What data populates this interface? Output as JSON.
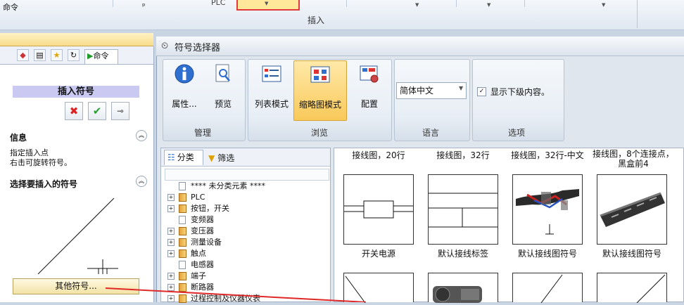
{
  "top_ribbon": {
    "plc_label": "PLC",
    "group_label": "插入"
  },
  "command_panel": {
    "title": "命令",
    "pin_glyph": "ᵖ",
    "tab_label": "命令",
    "insert_symbol_title": "插入符号",
    "buttons": {
      "cancel_glyph": "✖",
      "ok_glyph": "✔",
      "pin_glyph": "⊸"
    },
    "info_section": {
      "title": "信息",
      "lines": [
        "指定插入点",
        "右击可旋转符号。"
      ]
    },
    "choose_section": {
      "title": "选择要插入的符号"
    },
    "other_symbols_label": "其他符号..."
  },
  "selector": {
    "window_title": "符号选择器",
    "groups": [
      {
        "label": "管理",
        "buttons": [
          "属性...",
          "预览"
        ]
      },
      {
        "label": "浏览",
        "buttons": [
          "列表模式",
          "缩略图模式",
          "配置"
        ]
      },
      {
        "label": "语言",
        "select_value": "简体中文"
      },
      {
        "label": "选项",
        "checkbox_label": "显示下级内容。",
        "checkbox_checked": true
      }
    ],
    "tree_tabs": {
      "category": "分类",
      "filter": "筛选"
    },
    "tree_items": [
      {
        "label": "**** 未分类元素 ****",
        "expandable": false,
        "icon": "doc"
      },
      {
        "label": "PLC",
        "expandable": true,
        "icon": "book"
      },
      {
        "label": "按钮，开关",
        "expandable": true,
        "icon": "book"
      },
      {
        "label": "变频器",
        "expandable": false,
        "icon": "doc"
      },
      {
        "label": "变压器",
        "expandable": true,
        "icon": "book"
      },
      {
        "label": "测量设备",
        "expandable": true,
        "icon": "book"
      },
      {
        "label": "触点",
        "expandable": true,
        "icon": "book"
      },
      {
        "label": "电感器",
        "expandable": false,
        "icon": "doc"
      },
      {
        "label": "端子",
        "expandable": true,
        "icon": "book"
      },
      {
        "label": "断路器",
        "expandable": true,
        "icon": "book"
      },
      {
        "label": "过程控制及仪器仪表",
        "expandable": true,
        "icon": "book"
      }
    ],
    "thumbnail_top_captions": [
      "接线图，20行",
      "接线图，32行",
      "接线图，32行-中文",
      "接线图，8个连接点，黑盒前4"
    ],
    "thumbnails": [
      {
        "caption": "开关电源",
        "kind": "switch"
      },
      {
        "caption": "默认接线标签",
        "kind": "label"
      },
      {
        "caption": "默认接线图符号",
        "kind": "cable-photo"
      },
      {
        "caption": "默认接线图符号",
        "kind": "cable-photo-2"
      }
    ]
  }
}
